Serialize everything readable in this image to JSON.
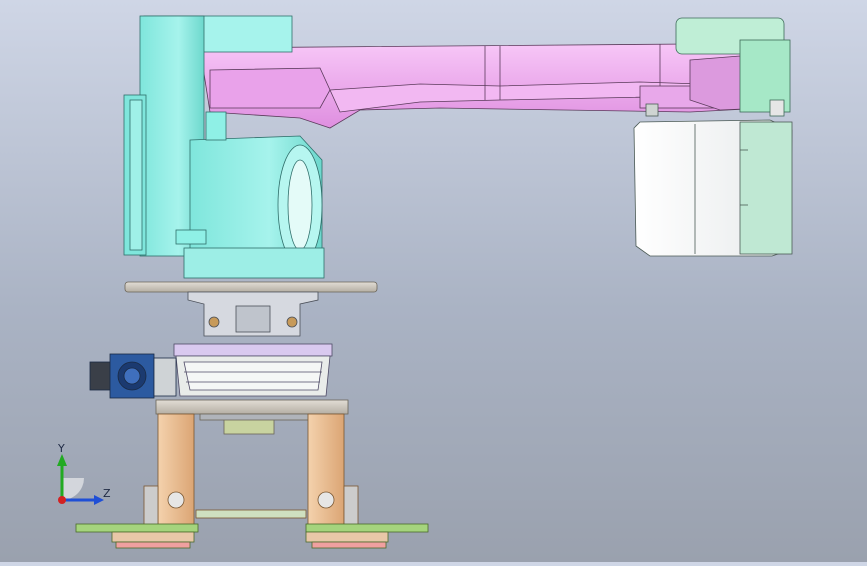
{
  "viewport": {
    "background_top": "#cfd6e6",
    "background_bottom": "#9aa1ae"
  },
  "model": {
    "description_visible": "",
    "colors": {
      "arm_magenta": "#f0a6f0",
      "arm_magenta_dark": "#d77fd7",
      "cyan_body": "#8ff0e6",
      "cyan_dark": "#55cfc4",
      "mint_end": "#a6e8c7",
      "tan_frame": "#f0c59a",
      "tan_dark": "#cf9c6a",
      "plate_gray": "#c9c3ba",
      "steel": "#b8bcc4",
      "white_tool": "#f1f3f4",
      "green_plate": "#a5d47d",
      "motor_blue": "#2c5aa0"
    }
  },
  "triad": {
    "y_label": "Y",
    "z_label": "Z",
    "y_color": "#22aa22",
    "z_color": "#1f4fd6",
    "x_color": "#d22222"
  }
}
